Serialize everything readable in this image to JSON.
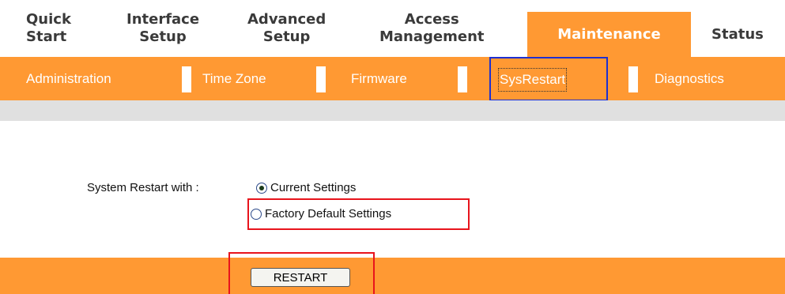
{
  "main_nav": {
    "tabs": [
      {
        "line1": "Quick",
        "line2": "Start"
      },
      {
        "line1": "Interface",
        "line2": "Setup"
      },
      {
        "line1": "Advanced",
        "line2": "Setup"
      },
      {
        "line1": "Access",
        "line2": "Management"
      },
      {
        "label": "Maintenance",
        "active": true
      },
      {
        "label": "Status"
      }
    ]
  },
  "sub_nav": {
    "items": [
      "Administration",
      "Time Zone",
      "Firmware",
      "SysRestart",
      "Diagnostics"
    ],
    "selected": "SysRestart"
  },
  "form": {
    "label": "System Restart with :",
    "options": [
      {
        "label": "Current Settings",
        "checked": true
      },
      {
        "label": "Factory Default Settings",
        "checked": false
      }
    ],
    "button_label": "RESTART"
  },
  "colors": {
    "accent": "#ff9933",
    "highlight_blue": "#1e2fd0",
    "highlight_red": "#e8141c",
    "gray_bar": "#e0e0e0"
  }
}
